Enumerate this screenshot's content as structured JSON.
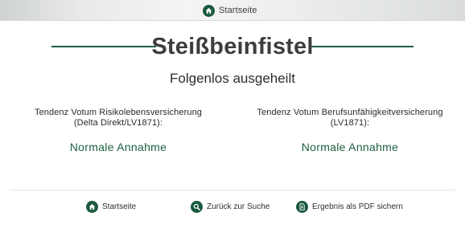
{
  "topbar": {
    "home_label": "Startseite",
    "home_icon": "home-icon"
  },
  "header": {
    "title": "Steißbeinfistel",
    "subtitle": "Folgenlos ausgeheilt"
  },
  "votes": [
    {
      "heading_line1": "Tendenz Votum Risikolebensversicherung",
      "heading_line2": "(Delta Direkt/LV1871):",
      "result": "Normale Annahme"
    },
    {
      "heading_line1": "Tendenz Votum Berufsunfähigkeitversicherung",
      "heading_line2": "(LV1871):",
      "result": "Normale Annahme"
    }
  ],
  "footer": {
    "home_label": "Startseite",
    "back_label": "Zurück zur Suche",
    "pdf_label": "Ergebnis als PDF sichern"
  },
  "colors": {
    "accent": "#1a5a3f",
    "result_text": "#1d5f41"
  }
}
